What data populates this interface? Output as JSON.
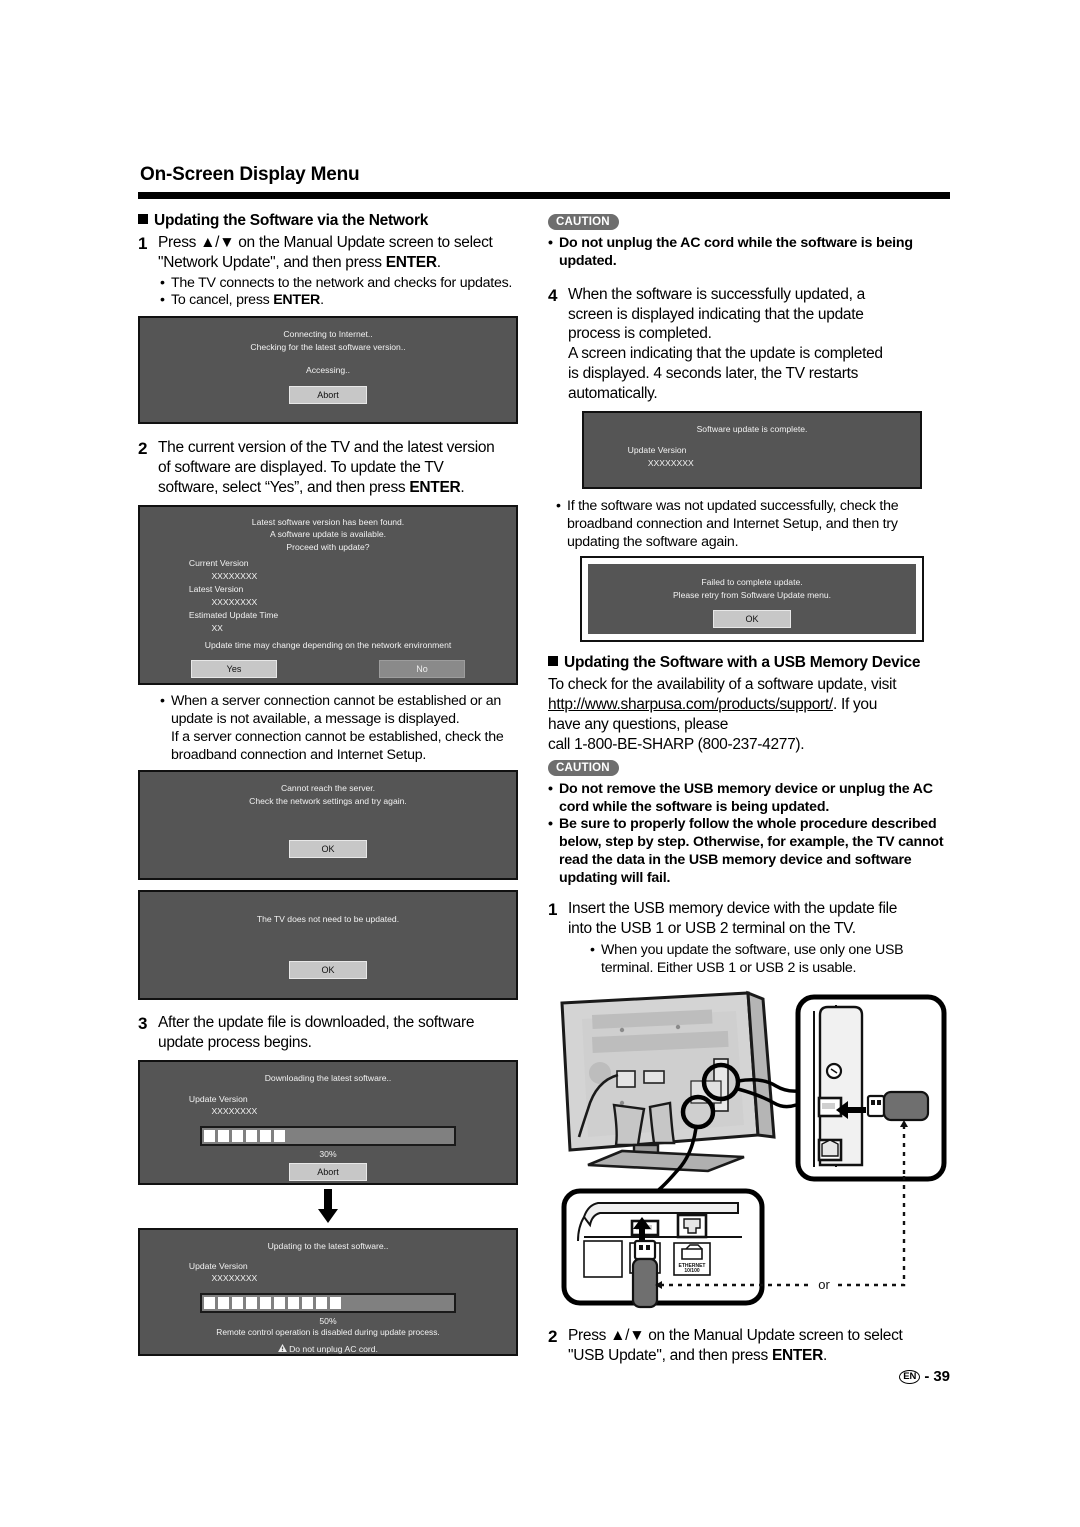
{
  "header": {
    "title": "On-Screen Display Menu"
  },
  "left": {
    "section_heading": "Updating the Software via the Network",
    "step1": {
      "num": "1",
      "line1_a": "Press ",
      "line1_arrows": "▲/▼",
      "line1_b": " on the Manual Update screen to select",
      "line2_a": "\"Network Update\", and then press ",
      "line2_bold": "ENTER",
      "line2_c": "."
    },
    "step1_bullets": [
      "The TV connects to the network and checks for updates.",
      "To cancel, press ENTER."
    ],
    "dialog_connecting": {
      "line1": "Connecting to Internet..",
      "line2": "Checking for the latest software version..",
      "line3": "Accessing..",
      "button": "Abort"
    },
    "step2": {
      "num": "2",
      "line1": "The current version of the TV and the latest version",
      "line2": "of software are displayed. To update the TV",
      "line3_a": "software, select “Yes”, and then press ",
      "line3_bold": "ENTER",
      "line3_c": "."
    },
    "dialog_found": {
      "line1": "Latest software version has been found.",
      "line2": "A software update is available.",
      "line3": "Proceed with update?",
      "label_current": "Current Version",
      "value_current": "XXXXXXXX",
      "label_latest": "Latest Version",
      "value_latest": "XXXXXXXX",
      "label_est": "Estimated Update Time",
      "value_est": "XX",
      "note": "Update time may change depending on the network environment",
      "button_yes": "Yes",
      "button_no": "No"
    },
    "bullet_server": {
      "l1": "When a server connection cannot be established or an",
      "l2": "update is not available, a message is displayed.",
      "l3": "If a server connection cannot be established, check the",
      "l4": "broadband connection and Internet Setup."
    },
    "dialog_cannot_reach": {
      "line1": "Cannot reach the server.",
      "line2": "Check the network settings and try again.",
      "button": "OK"
    },
    "dialog_no_update": {
      "line1": "The TV does not need to be updated.",
      "button": "OK"
    },
    "step3": {
      "num": "3",
      "line1": "After the update file is downloaded, the software",
      "line2": "update process begins."
    },
    "dialog_downloading": {
      "line1": "Downloading the latest software..",
      "label_version": "Update Version",
      "value_version": "XXXXXXXX",
      "percent": "30%",
      "blocks": 6,
      "button": "Abort"
    },
    "dialog_updating": {
      "line1": "Updating to the latest software..",
      "label_version": "Update Version",
      "value_version": "XXXXXXXX",
      "percent": "50%",
      "blocks": 10,
      "note": "Remote control operation is disabled during update process.",
      "warn": "Do not unplug AC cord."
    }
  },
  "right": {
    "caution1_label": "CAUTION",
    "caution1_items": [
      "Do not unplug the AC cord while the software is being updated."
    ],
    "step4": {
      "num": "4",
      "l1": "When the software is successfully updated, a",
      "l2": "screen is displayed indicating that the update",
      "l3": "process is completed.",
      "l4": "A screen indicating that the update is completed",
      "l5": "is displayed. 4 seconds later, the TV restarts",
      "l6": "automatically."
    },
    "dialog_complete": {
      "line1": "Software update is complete.",
      "label_version": "Update Version",
      "value_version": "XXXXXXXX"
    },
    "bullet_failed": {
      "l1": "If the software was not updated successfully, check the",
      "l2": "broadband connection and Internet Setup, and then try",
      "l3": "updating the software again."
    },
    "dialog_failed": {
      "line1": "Failed to complete update.",
      "line2": "Please retry from Software Update menu.",
      "button": "OK"
    },
    "usb_section_heading": "Updating the Software with a USB Memory Device",
    "usb_intro": {
      "l1": "To check for the availability of a software update, visit",
      "l2_link": "http://www.sharpusa.com/products/support/",
      "l2_rest": ". If you",
      "l3": "have any questions, please",
      "l4": "call 1-800-BE-SHARP (800-237-4277)."
    },
    "caution2_label": "CAUTION",
    "caution2_items": [
      "Do not remove the USB memory device or unplug the AC cord while the software is being updated.",
      "Be sure to properly follow the whole procedure described below, step by step. Otherwise, for example, the TV cannot read the data in the USB memory device and software updating will fail."
    ],
    "usb_step1": {
      "num": "1",
      "l1": "Insert the USB memory device with the update file",
      "l2": "into the USB 1 or USB 2 terminal on the TV."
    },
    "usb_step1_bullet": {
      "l1": "When you update the software, use only one USB",
      "l2": "terminal. Either USB 1 or USB 2 is usable."
    },
    "illustration": {
      "or_label": "or",
      "ethernet_label": "ETHERNET\n10/100"
    },
    "usb_step2": {
      "num": "2",
      "l1_a": "Press ",
      "l1_arrows": "▲/▼",
      "l1_b": " on the Manual Update screen to select",
      "l2_a": "\"USB Update\", and then press ",
      "l2_bold": "ENTER",
      "l2_c": "."
    }
  },
  "footer": {
    "lang_badge": "EN",
    "separator": "-",
    "page_number": "39"
  },
  "colors": {
    "osd_background": "#555555",
    "osd_text": "#f2f2f2",
    "button_face": "#c7c7c7",
    "button_dim": "#8a8a8a",
    "caution_badge": "#6e6e6e",
    "rule": "#000000"
  }
}
